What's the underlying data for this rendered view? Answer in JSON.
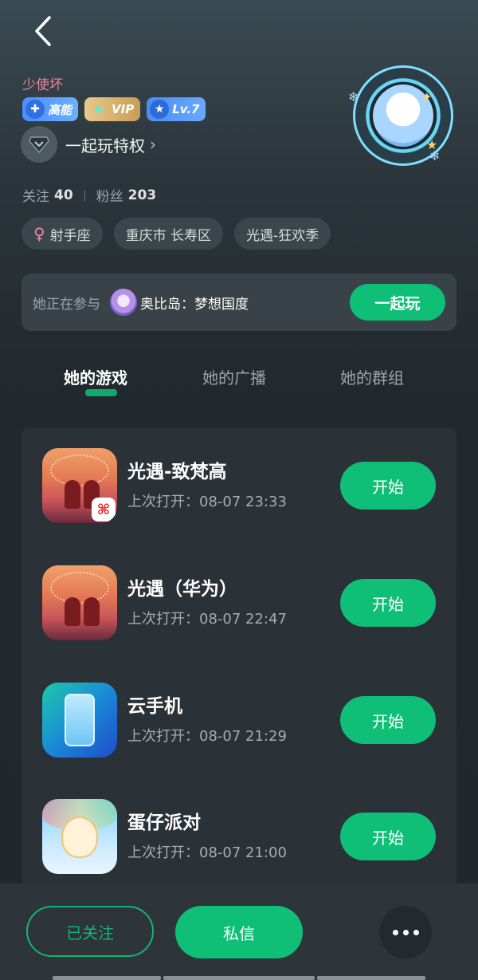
{
  "profile": {
    "username": "少使坏",
    "badges": {
      "gaoneng": "高能",
      "vip": "VIP",
      "level": "Lv.7"
    },
    "privilege_label": "一起玩特权",
    "stats": {
      "following_label": "关注",
      "following_count": "40",
      "fans_label": "粉丝",
      "fans_count": "203"
    },
    "tags": [
      "射手座",
      "重庆市 长寿区",
      "光遇-狂欢季"
    ]
  },
  "playing": {
    "prefix": "她正在参与",
    "game_name": "奥比岛：梦想国度",
    "join_label": "一起玩"
  },
  "tabs": [
    {
      "label": "她的游戏",
      "active": true
    },
    {
      "label": "她的广播",
      "active": false
    },
    {
      "label": "她的群组",
      "active": false
    }
  ],
  "games": [
    {
      "title": "光遇-致梵高",
      "subtitle": "上次打开：08-07 23:33",
      "button": "开始",
      "icon": "sky-game-icon"
    },
    {
      "title": "光遇（华为）",
      "subtitle": "上次打开：08-07 22:47",
      "button": "开始",
      "icon": "sky-game-icon"
    },
    {
      "title": "云手机",
      "subtitle": "上次打开：08-07 21:29",
      "button": "开始",
      "icon": "cloud-phone-icon"
    },
    {
      "title": "蛋仔派对",
      "subtitle": "上次打开：08-07 21:00",
      "button": "开始",
      "icon": "eggy-party-icon"
    }
  ],
  "bottom": {
    "follow_label": "已关注",
    "message_label": "私信"
  },
  "colors": {
    "accent_green": "#10bf77",
    "username_pink": "#e9849b",
    "background_dark": "#21272c"
  }
}
